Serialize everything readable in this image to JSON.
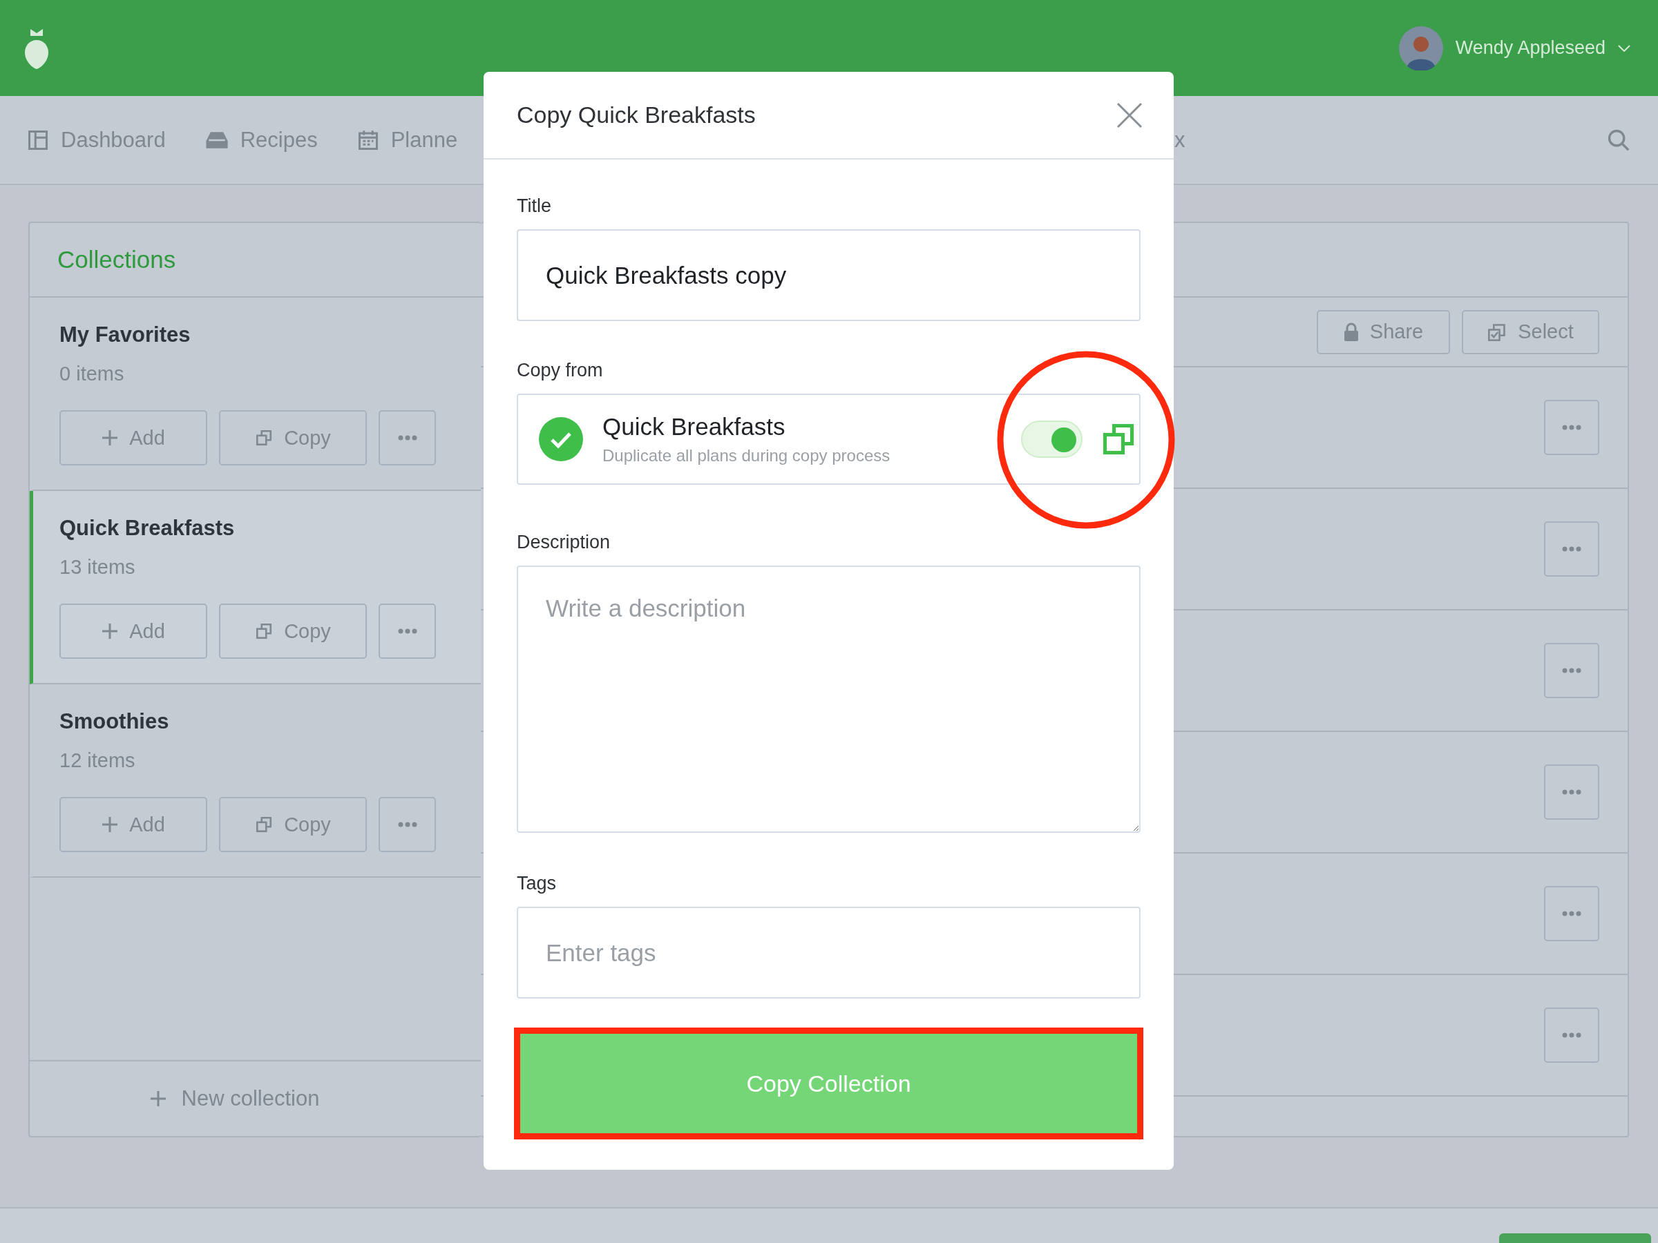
{
  "header": {
    "user_name": "Wendy Appleseed"
  },
  "nav": {
    "items": [
      {
        "label": "Dashboard",
        "kind": "dashboard"
      },
      {
        "label": "Recipes",
        "kind": "recipes"
      },
      {
        "label": "Planne",
        "kind": "planner"
      }
    ],
    "fragment": "x"
  },
  "collections": {
    "title": "Collections",
    "items": [
      {
        "name": "My Favorites",
        "count": "0 items",
        "selected": false,
        "add_label": "Add",
        "copy_label": "Copy"
      },
      {
        "name": "Quick Breakfasts",
        "count": "13 items",
        "selected": true,
        "add_label": "Add",
        "copy_label": "Copy"
      },
      {
        "name": "Smoothies",
        "count": "12 items",
        "selected": false,
        "add_label": "Add",
        "copy_label": "Copy"
      }
    ],
    "new_collection": "New collection"
  },
  "toolbar": {
    "share": "Share",
    "select": "Select"
  },
  "modal": {
    "title": "Copy Quick Breakfasts",
    "title_field": {
      "label": "Title",
      "value": "Quick Breakfasts copy"
    },
    "copy_from": {
      "label": "Copy from",
      "name": "Quick Breakfasts",
      "description": "Duplicate all plans during copy process",
      "checked": true,
      "duplicate_on": true
    },
    "description": {
      "label": "Description",
      "placeholder": "Write a description"
    },
    "tags": {
      "label": "Tags",
      "placeholder": "Enter tags"
    },
    "submit": "Copy Collection"
  }
}
